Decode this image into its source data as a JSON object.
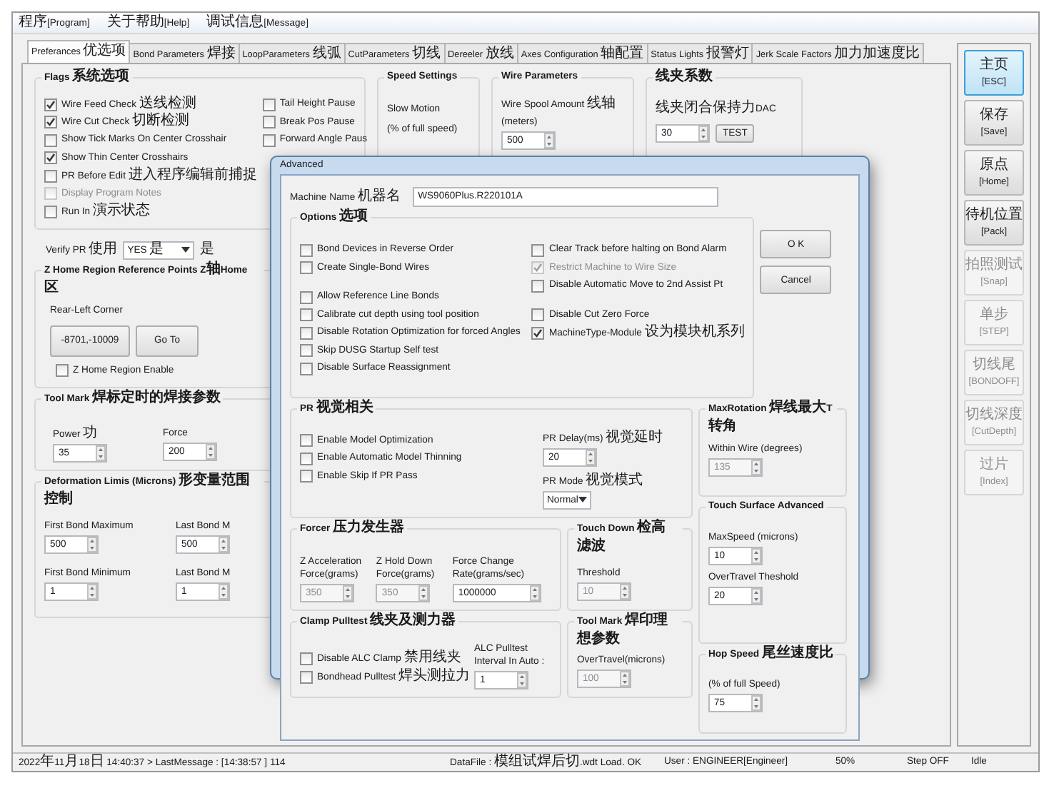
{
  "menu": [
    {
      "label": "程序[Program]"
    },
    {
      "label": "关于帮助[Help]"
    },
    {
      "label": "调试信息[Message]"
    }
  ],
  "tabs": [
    {
      "label": "Preferances 优选项",
      "selected": true
    },
    {
      "label": "Bond Parameters 焊接",
      "selected": false
    },
    {
      "label": "LoopParameters 线弧",
      "selected": false
    },
    {
      "label": "CutParameters 切线",
      "selected": false
    },
    {
      "label": "Dereeler 放线",
      "selected": false
    },
    {
      "label": "Axes Configuration 轴配置",
      "selected": false
    },
    {
      "label": "Status Lights 报警灯",
      "selected": false
    },
    {
      "label": "Jerk Scale Factors 加力加速度比",
      "selected": false
    }
  ],
  "prefs": {
    "flags": {
      "title": "Flags 系统选项",
      "col1": [
        {
          "label": "Wire Feed Check 送线检测",
          "checked": true,
          "disabled": false
        },
        {
          "label": "Wire Cut Check 切断检测",
          "checked": true,
          "disabled": false
        },
        {
          "label": "Show Tick Marks On Center Crosshair",
          "checked": false,
          "disabled": false
        },
        {
          "label": "Show Thin Center Crosshairs",
          "checked": true,
          "disabled": false
        },
        {
          "label": "PR Before Edit 进入程序编辑前捕捉",
          "checked": false,
          "disabled": false
        },
        {
          "label": "Display Program Notes",
          "checked": false,
          "disabled": true
        },
        {
          "label": "Run In 演示状态",
          "checked": false,
          "disabled": false
        }
      ],
      "col2": [
        {
          "label": "Tail Height Pause",
          "checked": false,
          "disabled": false
        },
        {
          "label": "Break Pos Pause",
          "checked": false,
          "disabled": false
        },
        {
          "label": "Forward Angle Paus",
          "checked": false,
          "disabled": false
        }
      ]
    },
    "speed": {
      "title": "Speed Settings",
      "lines": [
        "Slow Motion",
        "(% of full speed)"
      ]
    },
    "wire": {
      "title": "Wire Parameters",
      "label": "Wire Spool Amount 线轴",
      "unit": "(meters)",
      "value": "500"
    },
    "clamp": {
      "title": "线夹系数",
      "label": "线夹闭合保持力DAC",
      "value": "30",
      "button": "TEST"
    },
    "verify_pr": {
      "label": "Verify PR 使用",
      "value": "YES 是",
      "after": "是"
    },
    "z_home": {
      "title": "Z Home Region Reference Points Z轴Home区",
      "corner_label": "Rear-Left Corner",
      "position_button": "-8701,-10009",
      "goto_button": "Go To",
      "enable": {
        "label": "Z Home Region Enable",
        "checked": false,
        "disabled": false
      }
    },
    "tool_mark": {
      "title": "Tool Mark 焊标定时的焊接参数",
      "fields": [
        {
          "label": "Power 功",
          "value": "35"
        },
        {
          "label": "Force",
          "value": "200"
        }
      ]
    },
    "deformation": {
      "title": "Deformation Limis (Microns) 形变量范围控制",
      "fields": [
        {
          "label": "First Bond Maximum",
          "value": "500"
        },
        {
          "label": "Last Bond M",
          "value": "500"
        },
        {
          "label": "First Bond Minimum",
          "value": "1"
        },
        {
          "label": "Last Bond M",
          "value": "1"
        }
      ]
    }
  },
  "dialog": {
    "title": "Advanced",
    "machine_name": {
      "label": "Machine Name 机器名",
      "value": "WS9060Plus.R220101A"
    },
    "options": {
      "title": "Options 选项",
      "left": [
        [
          {
            "label": "Bond Devices in Reverse Order",
            "checked": false,
            "disabled": false
          },
          {
            "label": "Create Single-Bond Wires",
            "checked": false,
            "disabled": false
          }
        ],
        [
          {
            "label": "Allow Reference Line Bonds",
            "checked": false,
            "disabled": false
          },
          {
            "label": "Calibrate cut depth using tool position",
            "checked": false,
            "disabled": false
          },
          {
            "label": "Disable Rotation Optimization for forced Angles",
            "checked": false,
            "disabled": false
          },
          {
            "label": "Skip DUSG Startup Self test",
            "checked": false,
            "disabled": false
          },
          {
            "label": "Disable Surface Reassignment",
            "checked": false,
            "disabled": false
          }
        ]
      ],
      "right": [
        [
          {
            "label": "Clear Track before halting on Bond Alarm",
            "checked": false,
            "disabled": false
          },
          {
            "label": "Restrict Machine to Wire Size",
            "checked": true,
            "disabled": true
          },
          {
            "label": "Disable Automatic Move to 2nd Assist Pt",
            "checked": false,
            "disabled": false
          }
        ],
        [
          {
            "label": "Disable Cut Zero Force",
            "checked": false,
            "disabled": false
          },
          {
            "label": "MachineType-Module 设为模块机系列",
            "checked": true,
            "disabled": false
          }
        ]
      ]
    },
    "buttons": [
      "O K",
      "Cancel"
    ],
    "pr": {
      "title": "PR 视觉相关",
      "checks": [
        {
          "label": "Enable Model Optimization",
          "checked": false,
          "disabled": false
        },
        {
          "label": "Enable Automatic Model Thinning",
          "checked": false,
          "disabled": false
        },
        {
          "label": "Enable Skip If PR Pass",
          "checked": false,
          "disabled": false
        }
      ],
      "delay": {
        "label": "PR Delay(ms) 视觉延时",
        "value": "20",
        "disabled": false
      },
      "mode": {
        "label": "PR Mode 视觉模式",
        "value": "Normal"
      }
    },
    "forcer": {
      "title": "Forcer 压力发生器",
      "fields": [
        {
          "label": "Z Acceleration Force(grams)",
          "value": "350",
          "disabled": true
        },
        {
          "label": "Z Hold Down Force(grams)",
          "value": "350",
          "disabled": true
        },
        {
          "label": "Force Change Rate(grams/sec)",
          "value": "1000000",
          "disabled": false
        }
      ]
    },
    "touch_down": {
      "title": "Touch Down 检高滤波",
      "fields": [
        {
          "label": "Threshold",
          "value": "10",
          "disabled": true
        }
      ]
    },
    "clamp": {
      "title": "Clamp  Pulltest 线夹及测力器",
      "checks": [
        {
          "label": "Disable ALC Clamp 禁用线夹",
          "checked": false,
          "disabled": false
        },
        {
          "label": "Bondhead Pulltest 焊头测拉力",
          "checked": false,
          "disabled": false
        }
      ],
      "interval": {
        "label": "ALC Pulltest Interval In Auto :",
        "value": "1",
        "disabled": false
      }
    },
    "tool_mark": {
      "title": "Tool Mark 焊印理想参数",
      "fields": [
        {
          "label": "OverTravel(microns)",
          "value": "100",
          "disabled": true
        }
      ]
    },
    "max_rotation": {
      "title": "MaxRotation 焊线最大T转角",
      "fields": [
        {
          "label": "Within Wire (degrees)",
          "value": "135",
          "disabled": true
        }
      ]
    },
    "touch_surface": {
      "title": "Touch Surface Advanced",
      "fields": [
        {
          "label": "MaxSpeed (microns)",
          "value": "10",
          "disabled": false
        },
        {
          "label": "OverTravel Theshold",
          "value": "20",
          "disabled": false
        }
      ]
    },
    "hop_speed": {
      "title": "Hop Speed 尾丝速度比",
      "fields": [
        {
          "label": "(% of full Speed)",
          "value": "75",
          "disabled": false
        }
      ]
    }
  },
  "sidebar": [
    {
      "label": "主页",
      "key": "[ESC]",
      "selected": true,
      "disabled": false
    },
    {
      "label": "保存",
      "key": "[Save]",
      "selected": false,
      "disabled": false
    },
    {
      "label": "原点",
      "key": "[Home]",
      "selected": false,
      "disabled": false
    },
    {
      "label": "待机位置",
      "key": "[Pack]",
      "selected": false,
      "disabled": false
    },
    {
      "label": "拍照测试",
      "key": "[Snap]",
      "selected": false,
      "disabled": true
    },
    {
      "label": "单步",
      "key": "[STEP]",
      "selected": false,
      "disabled": true
    },
    {
      "label": "切线尾",
      "key": "[BONDOFF]",
      "selected": false,
      "disabled": true
    },
    {
      "label": "切线深度",
      "key": "[CutDepth]",
      "selected": false,
      "disabled": true
    },
    {
      "label": "过片",
      "key": "[Index]",
      "selected": false,
      "disabled": true
    }
  ],
  "status_bar": [
    "2022年11月18日 14:40:37 > LastMessage : [14:38:57 ] 114",
    "DataFile : 模组试焊后切.wdt Load. OK",
    "User : ENGINEER[Engineer]",
    "50%",
    "Step OFF",
    "Idle"
  ]
}
